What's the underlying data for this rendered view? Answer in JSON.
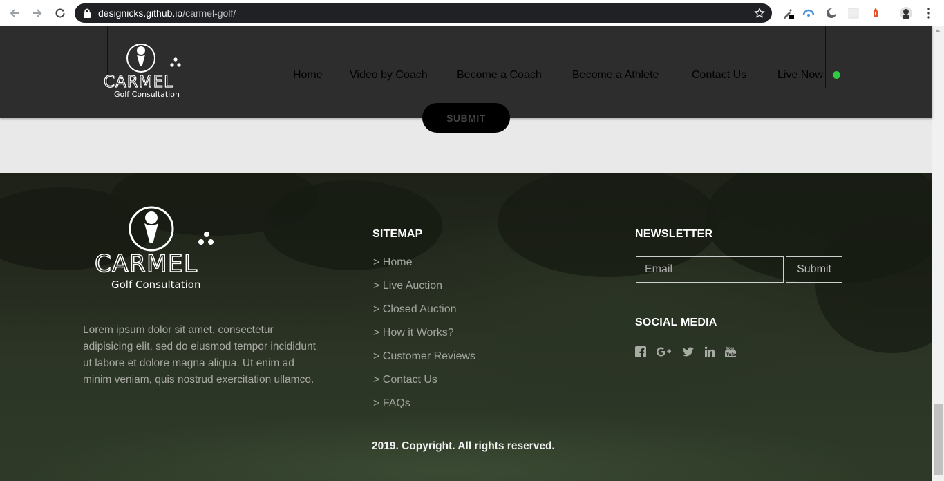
{
  "browser": {
    "url_host": "designicks.github.io",
    "url_path": "/carmel-golf/"
  },
  "header": {
    "nav": [
      {
        "label": "Home"
      },
      {
        "label": "Video by Coach"
      },
      {
        "label": "Become a Coach"
      },
      {
        "label": "Become a Athlete"
      },
      {
        "label": "Contact Us"
      },
      {
        "label": "Live Now"
      }
    ],
    "live_color": "#2ecc40"
  },
  "form": {
    "submit_label": "SUBMIT"
  },
  "logo": {
    "name": "CARMEL",
    "tagline": "Golf Consultation"
  },
  "footer": {
    "about": "Lorem ipsum dolor sit amet, consectetur adipisicing elit, sed do eiusmod tempor incididunt ut labore et dolore magna aliqua. Ut enim ad minim veniam, quis nostrud exercitation ullamco.",
    "sitemap_title": "SITEMAP",
    "sitemap": [
      {
        "label": "> Home"
      },
      {
        "label": "> Live Auction"
      },
      {
        "label": "> Closed Auction"
      },
      {
        "label": "> How it Works?"
      },
      {
        "label": "> Customer Reviews"
      },
      {
        "label": "> Contact Us"
      },
      {
        "label": "> FAQs"
      }
    ],
    "newsletter_title": "NEWSLETTER",
    "email_placeholder": "Email",
    "newsletter_submit": "Submit",
    "social_title": "SOCIAL MEDIA",
    "social": [
      "facebook-icon",
      "google-plus-icon",
      "twitter-icon",
      "linkedin-icon",
      "youtube-icon"
    ],
    "copyright": "2019. Copyright. All rights reserved."
  }
}
